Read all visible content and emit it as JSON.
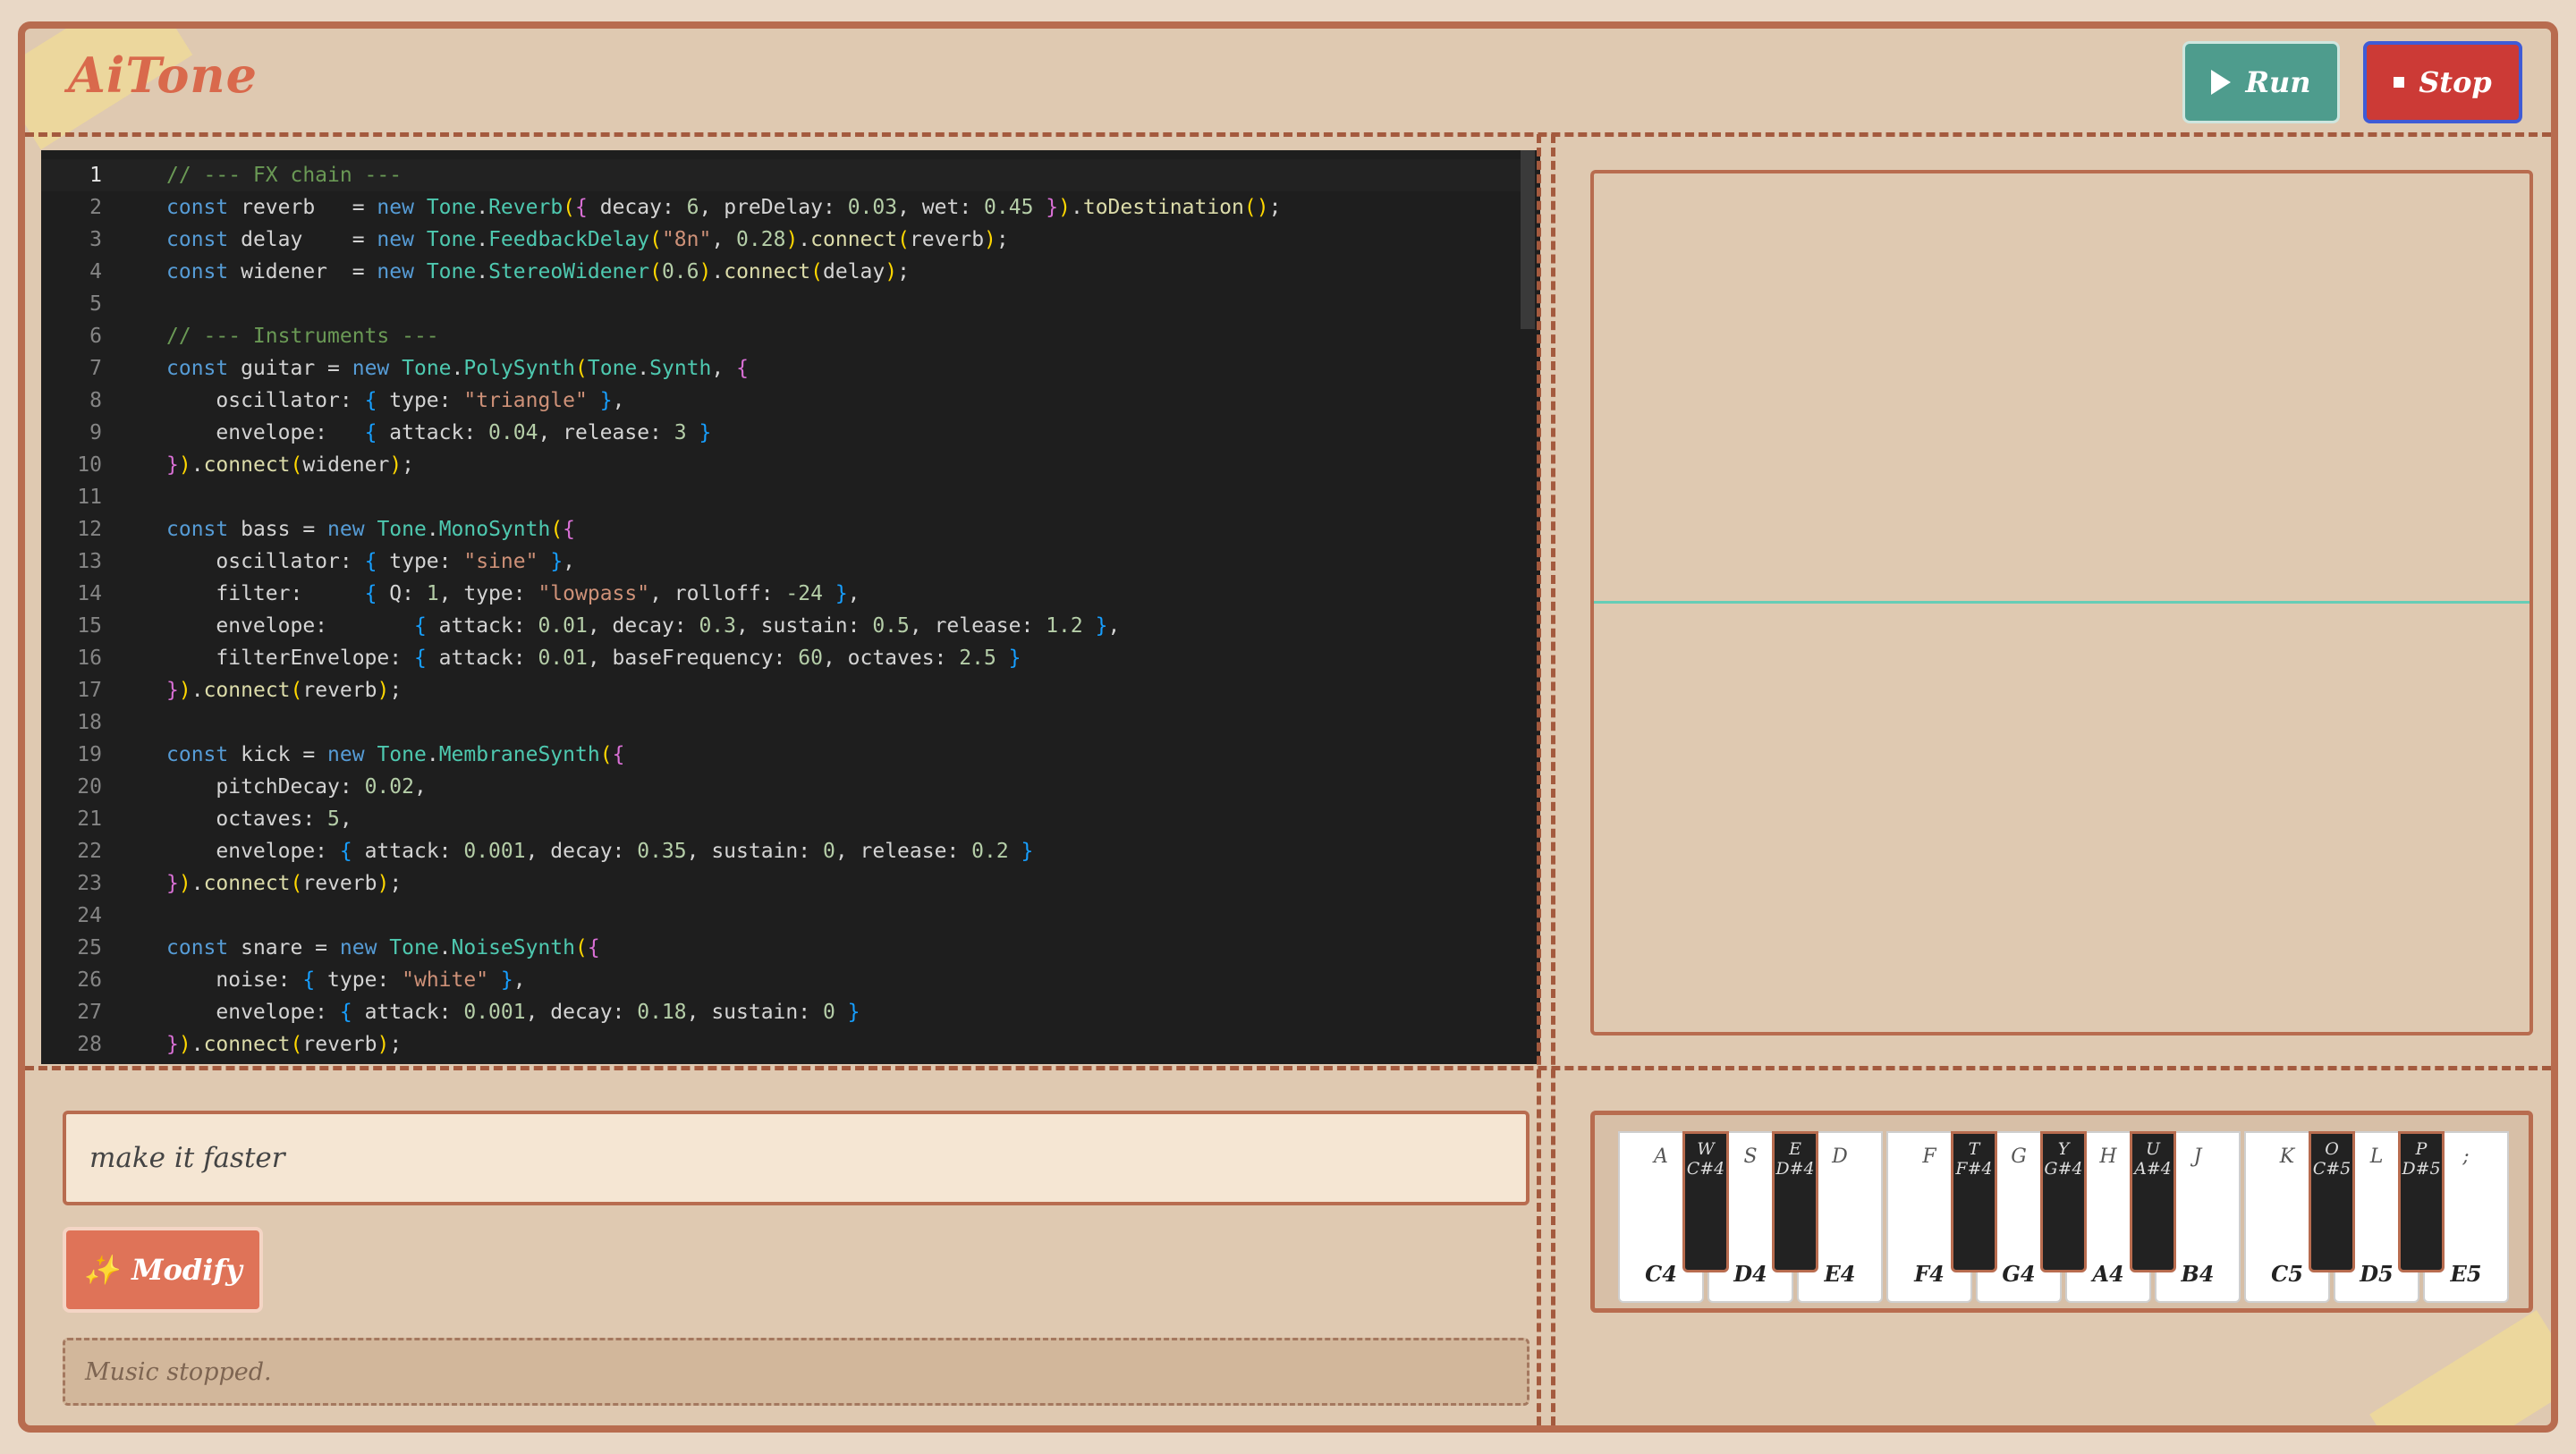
{
  "app": {
    "title": "AiTone"
  },
  "toolbar": {
    "run_label": "Run",
    "stop_label": "Stop"
  },
  "editor": {
    "lines": [
      {
        "n": "1",
        "html": "<span class=\"c\">// --- FX chain ---</span>"
      },
      {
        "n": "2",
        "html": "<span class=\"k\">const</span> reverb   = <span class=\"k\">new</span> <span class=\"t\">Tone</span>.<span class=\"t\">Reverb</span><span class=\"b1\">(</span><span class=\"b2\">{</span> decay: <span class=\"n\">6</span>, preDelay: <span class=\"n\">0.03</span>, wet: <span class=\"n\">0.45</span> <span class=\"b2\">}</span><span class=\"b1\">)</span>.<span class=\"f\">toDestination</span><span class=\"b1\">()</span>;"
      },
      {
        "n": "3",
        "html": "<span class=\"k\">const</span> delay    = <span class=\"k\">new</span> <span class=\"t\">Tone</span>.<span class=\"t\">FeedbackDelay</span><span class=\"b1\">(</span><span class=\"s\">\"8n\"</span>, <span class=\"n\">0.28</span><span class=\"b1\">)</span>.<span class=\"f\">connect</span><span class=\"b1\">(</span>reverb<span class=\"b1\">)</span>;"
      },
      {
        "n": "4",
        "html": "<span class=\"k\">const</span> widener  = <span class=\"k\">new</span> <span class=\"t\">Tone</span>.<span class=\"t\">StereoWidener</span><span class=\"b1\">(</span><span class=\"n\">0.6</span><span class=\"b1\">)</span>.<span class=\"f\">connect</span><span class=\"b1\">(</span>delay<span class=\"b1\">)</span>;"
      },
      {
        "n": "5",
        "html": ""
      },
      {
        "n": "6",
        "html": "<span class=\"c\">// --- Instruments ---</span>"
      },
      {
        "n": "7",
        "html": "<span class=\"k\">const</span> guitar = <span class=\"k\">new</span> <span class=\"t\">Tone</span>.<span class=\"t\">PolySynth</span><span class=\"b1\">(</span><span class=\"t\">Tone</span>.<span class=\"t\">Synth</span>, <span class=\"b2\">{</span>"
      },
      {
        "n": "8",
        "html": "    oscillator: <span class=\"b3\">{</span> type: <span class=\"s\">\"triangle\"</span> <span class=\"b3\">}</span>,"
      },
      {
        "n": "9",
        "html": "    envelope:   <span class=\"b3\">{</span> attack: <span class=\"n\">0.04</span>, release: <span class=\"n\">3</span> <span class=\"b3\">}</span>"
      },
      {
        "n": "10",
        "html": "<span class=\"b2\">}</span><span class=\"b1\">)</span>.<span class=\"f\">connect</span><span class=\"b1\">(</span>widener<span class=\"b1\">)</span>;"
      },
      {
        "n": "11",
        "html": ""
      },
      {
        "n": "12",
        "html": "<span class=\"k\">const</span> bass = <span class=\"k\">new</span> <span class=\"t\">Tone</span>.<span class=\"t\">MonoSynth</span><span class=\"b1\">(</span><span class=\"b2\">{</span>"
      },
      {
        "n": "13",
        "html": "    oscillator: <span class=\"b3\">{</span> type: <span class=\"s\">\"sine\"</span> <span class=\"b3\">}</span>,"
      },
      {
        "n": "14",
        "html": "    filter:     <span class=\"b3\">{</span> Q: <span class=\"n\">1</span>, type: <span class=\"s\">\"lowpass\"</span>, rolloff: <span class=\"n\">-24</span> <span class=\"b3\">}</span>,"
      },
      {
        "n": "15",
        "html": "    envelope:       <span class=\"b3\">{</span> attack: <span class=\"n\">0.01</span>, decay: <span class=\"n\">0.3</span>, sustain: <span class=\"n\">0.5</span>, release: <span class=\"n\">1.2</span> <span class=\"b3\">}</span>,"
      },
      {
        "n": "16",
        "html": "    filterEnvelope: <span class=\"b3\">{</span> attack: <span class=\"n\">0.01</span>, baseFrequency: <span class=\"n\">60</span>, octaves: <span class=\"n\">2.5</span> <span class=\"b3\">}</span>"
      },
      {
        "n": "17",
        "html": "<span class=\"b2\">}</span><span class=\"b1\">)</span>.<span class=\"f\">connect</span><span class=\"b1\">(</span>reverb<span class=\"b1\">)</span>;"
      },
      {
        "n": "18",
        "html": ""
      },
      {
        "n": "19",
        "html": "<span class=\"k\">const</span> kick = <span class=\"k\">new</span> <span class=\"t\">Tone</span>.<span class=\"t\">MembraneSynth</span><span class=\"b1\">(</span><span class=\"b2\">{</span>"
      },
      {
        "n": "20",
        "html": "    pitchDecay: <span class=\"n\">0.02</span>,"
      },
      {
        "n": "21",
        "html": "    octaves: <span class=\"n\">5</span>,"
      },
      {
        "n": "22",
        "html": "    envelope: <span class=\"b3\">{</span> attack: <span class=\"n\">0.001</span>, decay: <span class=\"n\">0.35</span>, sustain: <span class=\"n\">0</span>, release: <span class=\"n\">0.2</span> <span class=\"b3\">}</span>"
      },
      {
        "n": "23",
        "html": "<span class=\"b2\">}</span><span class=\"b1\">)</span>.<span class=\"f\">connect</span><span class=\"b1\">(</span>reverb<span class=\"b1\">)</span>;"
      },
      {
        "n": "24",
        "html": ""
      },
      {
        "n": "25",
        "html": "<span class=\"k\">const</span> snare = <span class=\"k\">new</span> <span class=\"t\">Tone</span>.<span class=\"t\">NoiseSynth</span><span class=\"b1\">(</span><span class=\"b2\">{</span>"
      },
      {
        "n": "26",
        "html": "    noise: <span class=\"b3\">{</span> type: <span class=\"s\">\"white\"</span> <span class=\"b3\">}</span>,"
      },
      {
        "n": "27",
        "html": "    envelope: <span class=\"b3\">{</span> attack: <span class=\"n\">0.001</span>, decay: <span class=\"n\">0.18</span>, sustain: <span class=\"n\">0</span> <span class=\"b3\">}</span>"
      },
      {
        "n": "28",
        "html": "<span class=\"b2\">}</span><span class=\"b1\">)</span>.<span class=\"f\">connect</span><span class=\"b1\">(</span>reverb<span class=\"b1\">)</span>;"
      }
    ]
  },
  "prompt": {
    "value": "make it faster"
  },
  "modify": {
    "label": "Modify",
    "icon": "sparkles-icon"
  },
  "status": {
    "text": "Music stopped."
  },
  "piano": {
    "white_keys": [
      {
        "key": "A",
        "note": "C4"
      },
      {
        "key": "S",
        "note": "D4"
      },
      {
        "key": "D",
        "note": "E4"
      },
      {
        "key": "F",
        "note": "F4"
      },
      {
        "key": "G",
        "note": "G4"
      },
      {
        "key": "H",
        "note": "A4"
      },
      {
        "key": "J",
        "note": "B4"
      },
      {
        "key": "K",
        "note": "C5"
      },
      {
        "key": "L",
        "note": "D5"
      },
      {
        "key": ";",
        "note": "E5"
      }
    ],
    "black_keys": [
      {
        "key": "W",
        "note": "C#4",
        "after": 0
      },
      {
        "key": "E",
        "note": "D#4",
        "after": 1
      },
      {
        "key": "T",
        "note": "F#4",
        "after": 3
      },
      {
        "key": "Y",
        "note": "G#4",
        "after": 4
      },
      {
        "key": "U",
        "note": "A#4",
        "after": 5
      },
      {
        "key": "O",
        "note": "C#5",
        "after": 7
      },
      {
        "key": "P",
        "note": "D#5",
        "after": 8
      }
    ]
  },
  "colors": {
    "accent_run": "#4e9c8d",
    "accent_stop": "#cc3a36",
    "accent_modify": "#df7358",
    "border": "#b86c4f",
    "waveform": "#66cdb6"
  }
}
